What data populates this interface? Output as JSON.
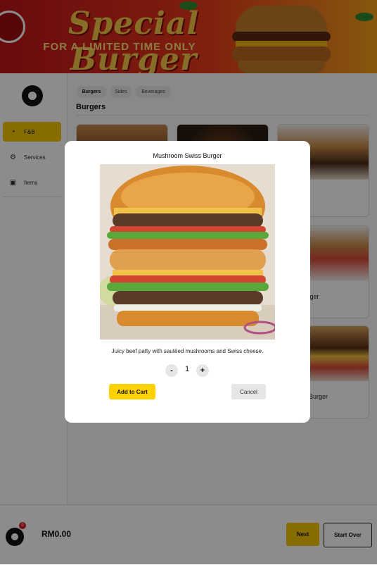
{
  "banner": {
    "title": "Special Burger",
    "subtitle": "FOR A LIMITED TIME ONLY"
  },
  "sidebar": {
    "items": [
      {
        "label": "F&B",
        "icon": "food-icon",
        "active": true
      },
      {
        "label": "Services",
        "icon": "gear-icon",
        "active": false
      },
      {
        "label": "Items",
        "icon": "box-icon",
        "active": false
      }
    ]
  },
  "main": {
    "tabs": [
      {
        "label": "Burgers",
        "active": true
      },
      {
        "label": "Sides",
        "active": false
      },
      {
        "label": "Beverages",
        "active": false
      }
    ],
    "section_title": "Burgers",
    "cards": [
      {
        "name": ""
      },
      {
        "name": ""
      },
      {
        "name": "urger"
      },
      {
        "name": "icken Burger"
      },
      {
        "name": "m Swiss Burger"
      }
    ]
  },
  "modal": {
    "title": "Mushroom Swiss Burger",
    "description": "Juicy beef patty with sautéed mushrooms and Swiss cheese.",
    "quantity": "1",
    "minus_label": "-",
    "plus_label": "+",
    "add_label": "Add to Cart",
    "cancel_label": "Cancel"
  },
  "bottom": {
    "cart_count": "0",
    "total": "RM0.00",
    "next_label": "Next",
    "start_over_label": "Start Over"
  },
  "colors": {
    "accent": "#f6c700",
    "overlay": "rgba(0,0,0,0.45)"
  }
}
